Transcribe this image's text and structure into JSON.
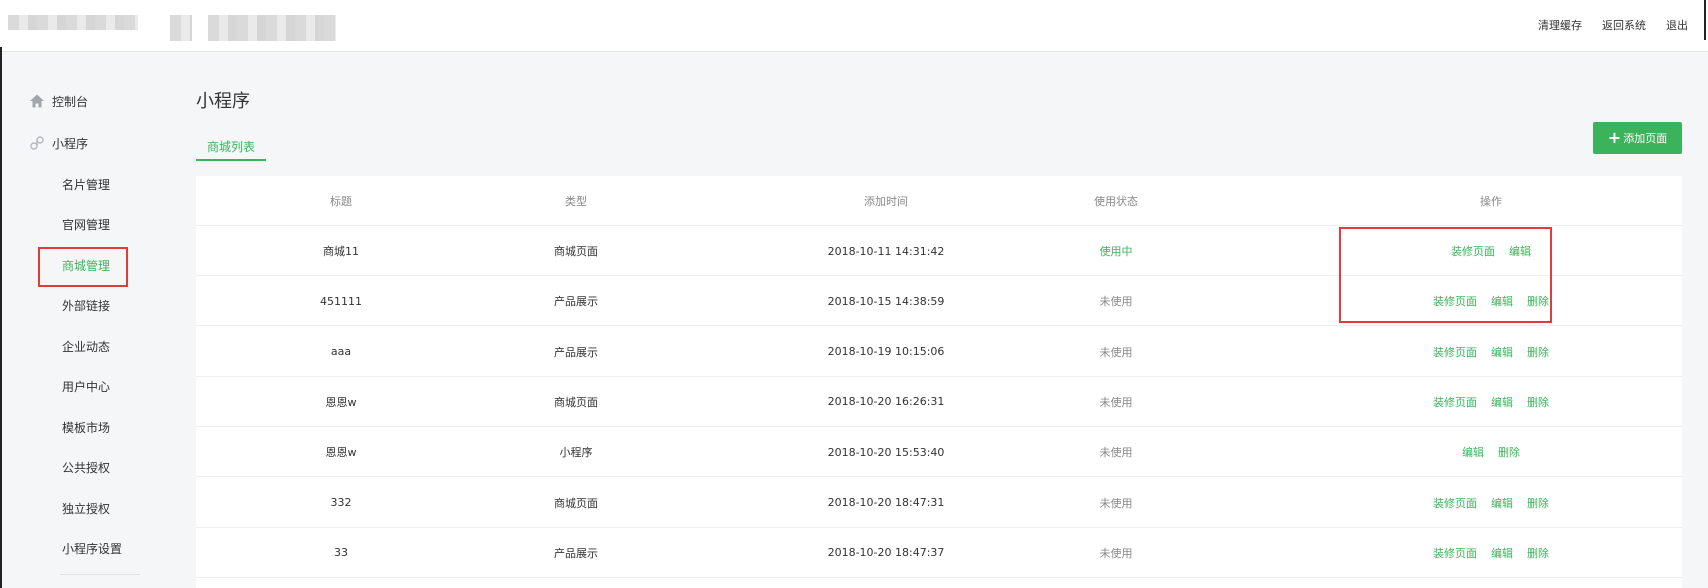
{
  "header": {
    "actions": [
      "清理缓存",
      "返回系统",
      "退出"
    ]
  },
  "sidebar": {
    "console_label": "控制台",
    "section_label": "小程序",
    "items": [
      {
        "label": "名片管理",
        "active": false
      },
      {
        "label": "官网管理",
        "active": false
      },
      {
        "label": "商城管理",
        "active": true
      },
      {
        "label": "外部链接",
        "active": false
      },
      {
        "label": "企业动态",
        "active": false
      },
      {
        "label": "用户中心",
        "active": false
      },
      {
        "label": "模板市场",
        "active": false
      },
      {
        "label": "公共授权",
        "active": false
      },
      {
        "label": "独立授权",
        "active": false
      },
      {
        "label": "小程序设置",
        "active": false
      }
    ]
  },
  "main": {
    "title": "小程序",
    "tab_label": "商城列表",
    "add_button_label": "添加页面"
  },
  "table": {
    "headers": [
      "标题",
      "类型",
      "添加时间",
      "使用状态",
      "操作"
    ],
    "rows": [
      {
        "title": "商城11",
        "type": "商城页面",
        "time": "2018-10-11 14:31:42",
        "status": "使用中",
        "ops": [
          "装修页面",
          "编辑"
        ]
      },
      {
        "title": "451111",
        "type": "产品展示",
        "time": "2018-10-15 14:38:59",
        "status": "未使用",
        "ops": [
          "装修页面",
          "编辑",
          "删除"
        ]
      },
      {
        "title": "aaa",
        "type": "产品展示",
        "time": "2018-10-19 10:15:06",
        "status": "未使用",
        "ops": [
          "装修页面",
          "编辑",
          "删除"
        ]
      },
      {
        "title": "恩恩w",
        "type": "商城页面",
        "time": "2018-10-20 16:26:31",
        "status": "未使用",
        "ops": [
          "装修页面",
          "编辑",
          "删除"
        ]
      },
      {
        "title": "恩恩w",
        "type": "小程序",
        "time": "2018-10-20 15:53:40",
        "status": "未使用",
        "ops": [
          "编辑",
          "删除"
        ]
      },
      {
        "title": "332",
        "type": "商城页面",
        "time": "2018-10-20 18:47:31",
        "status": "未使用",
        "ops": [
          "装修页面",
          "编辑",
          "删除"
        ]
      },
      {
        "title": "33",
        "type": "产品展示",
        "time": "2018-10-20 18:47:37",
        "status": "未使用",
        "ops": [
          "装修页面",
          "编辑",
          "删除"
        ]
      }
    ]
  },
  "colors": {
    "accent_green": "#3bb35a",
    "annotation_red": "#e23b3b"
  },
  "icons": {
    "console": "home-icon",
    "miniprogram": "miniprogram-icon",
    "add": "plus-icon"
  }
}
